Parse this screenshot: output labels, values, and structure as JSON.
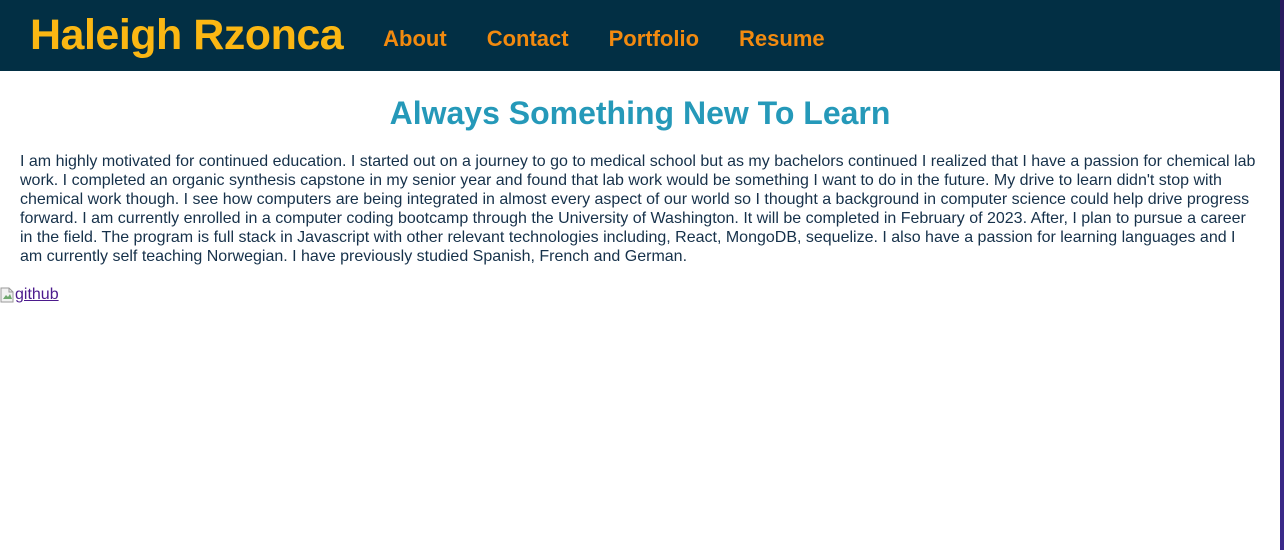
{
  "header": {
    "brand": "Haleigh Rzonca",
    "nav": [
      {
        "label": "About"
      },
      {
        "label": "Contact"
      },
      {
        "label": "Portfolio"
      },
      {
        "label": "Resume"
      }
    ]
  },
  "main": {
    "title": "Always Something New To Learn",
    "bio": "I am highly motivated for continued education. I started out on a journey to go to medical school but as my bachelors continued I realized that I have a passion for chemical lab work. I completed an organic synthesis capstone in my senior year and found that lab work would be something I want to do in the future. My drive to learn didn't stop with chemical work though. I see how computers are being integrated in almost every aspect of our world so I thought a background in computer science could help drive progress forward. I am currently enrolled in a computer coding bootcamp through the University of Washington. It will be completed in February of 2023. After, I plan to pursue a career in the field. The program is full stack in Javascript with other relevant technologies including, React, MongoDB, sequelize. I also have a passion for learning languages and I am currently self teaching Norwegian. I have previously studied Spanish, French and German.",
    "github_alt": "github"
  },
  "colors": {
    "navbar_bg": "#022f44",
    "brand": "#fbb713",
    "nav_link": "#f28a0f",
    "title": "#2599b9",
    "body_text": "#16314a",
    "link": "#4b1a8c"
  },
  "icons": {
    "github": "broken-image-icon"
  }
}
